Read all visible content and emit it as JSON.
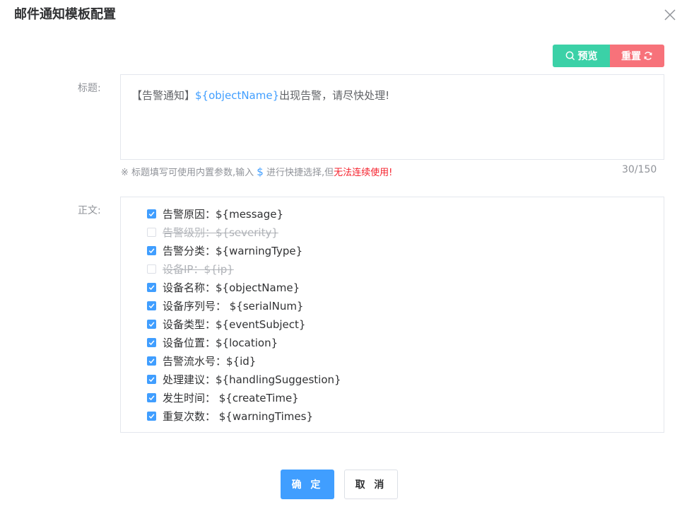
{
  "dialog": {
    "title": "邮件通知模板配置",
    "close_icon": "close-icon"
  },
  "toolbar": {
    "preview_label": "预览",
    "preview_icon": "search-icon",
    "reset_label": "重置",
    "reset_icon": "refresh-icon",
    "preview_color": "#3bd1a7",
    "reset_color": "#f7727a"
  },
  "subject": {
    "label": "标题:",
    "prefix": "【告警通知】",
    "variable": "${objectName}",
    "suffix": "出现告警，请尽快处理!",
    "hint_prefix": "※ 标题填写可使用内置参数,输入 ",
    "hint_dollar": "$",
    "hint_middle": " 进行快捷选择,但",
    "hint_warning": "无法连续使用!",
    "counter": "30/150"
  },
  "body": {
    "label": "正文:",
    "fields": [
      {
        "text": "告警原因：${message}",
        "checked": true
      },
      {
        "text": "告警级别：${severity}",
        "checked": false
      },
      {
        "text": "告警分类：${warningType}",
        "checked": true
      },
      {
        "text": "设备IP：${ip}",
        "checked": false
      },
      {
        "text": "设备名称：${objectName}",
        "checked": true
      },
      {
        "text": "设备序列号： ${serialNum}",
        "checked": true
      },
      {
        "text": "设备类型：${eventSubject}",
        "checked": true
      },
      {
        "text": "设备位置：${location}",
        "checked": true
      },
      {
        "text": "告警流水号：${id}",
        "checked": true
      },
      {
        "text": "处理建议：${handlingSuggestion}",
        "checked": true
      },
      {
        "text": "发生时间： ${createTime}",
        "checked": true
      },
      {
        "text": "重复次数： ${warningTimes}",
        "checked": true
      }
    ]
  },
  "footer": {
    "confirm_label": "确 定",
    "cancel_label": "取 消",
    "confirm_color": "#409eff"
  },
  "colors": {
    "accent": "#409eff",
    "warning_text": "#f5222d"
  }
}
